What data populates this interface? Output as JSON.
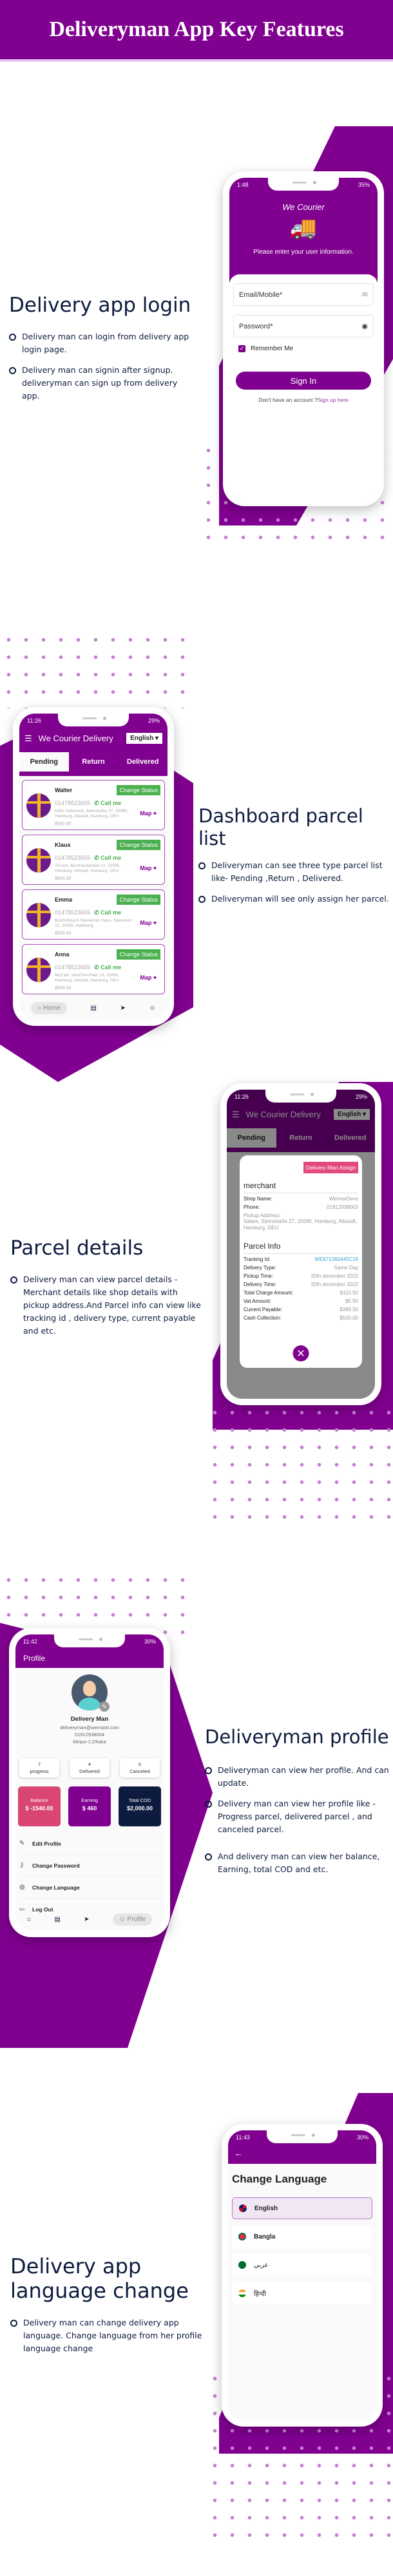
{
  "banner": {
    "title": "Deliveryman App Key Features"
  },
  "colors": {
    "brand": "#800090",
    "dot": "#c47fd1",
    "green": "#4cb050",
    "pink": "#e24a7e",
    "navy": "#0d1b3e"
  },
  "login": {
    "title": "Delivery app login",
    "bullets": [
      "Delivery man can login from delivery app login page.",
      "Delivery man can signin after signup. deliveryman can sign up from  delivery app."
    ],
    "phone": {
      "time": "1:48",
      "battery": "35%",
      "logo_text": "We Courier",
      "subtitle": "Please enter your user information.",
      "email_placeholder": "Email/Mobile*",
      "password_placeholder": "Password*",
      "remember": "Remember Me",
      "signin": "Sign In",
      "signup_prompt": "Don't have an account ?",
      "signup_link": "Sign up here"
    }
  },
  "dashboard": {
    "title": "Dashboard parcel list",
    "bullets": [
      "Deliveryman can see three type parcel list like- Pending ,Return , Delivered.",
      "Deliveryman will see only assign her parcel."
    ],
    "phone": {
      "time": "11:26",
      "battery": "29%",
      "app_title": "We Courier Delivery",
      "language": "English",
      "tabs": [
        "Pending",
        "Return",
        "Delivered"
      ],
      "change_status": "Change Status",
      "call_me": "Call me",
      "map": "Map",
      "parcels": [
        {
          "name": "Walter",
          "phone": "01478523655",
          "address": "Kölln Haferland, Steinstraße 27, 20095, Hamburg, Altstadt, Hamburg, DEU",
          "amount": "$500.00"
        },
        {
          "name": "Klaus",
          "phone": "01478523655",
          "address": "Trisons, Burchardstraße 22, 20095, Hamburg, Altstadt, Hamburg, DEU",
          "amount": "$500.00"
        },
        {
          "name": "Emma",
          "phone": "01478523655",
          "address": "Bischofsturm Steinernes Haus, Speersort 10, 20095, Hamburg, ...",
          "amount": "$500.00"
        },
        {
          "name": "Anna",
          "phone": "01478523655",
          "address": "McCafé, Ida-Ehre-Platz 10, 20095, Hamburg, Altstadt, Hamburg, DEU",
          "amount": "$500.00"
        }
      ],
      "nav_home": "Home"
    }
  },
  "details": {
    "title": "Parcel details",
    "bullets": [
      "Delivery man can view parcel details - Merchant details like  shop details with pickup address.And Parcel info can view like tracking id  ,  delivery type, current payable and etc."
    ],
    "phone": {
      "time": "11:26",
      "battery": "29%",
      "app_title": "We Courier Delivery",
      "language": "English",
      "tabs": [
        "Pending",
        "Return",
        "Delivered"
      ],
      "assign": "Delivery Man Assign",
      "merchant_heading": "merchant",
      "shop_label": "Shop Name:",
      "shop_value": "WemaxDevs",
      "phone_label": "Phone:",
      "phone_value": "01912938003",
      "pickup_label": "Pickup Address:",
      "pickup_value": "Salam, Steinstraße 27, 20095, Hamburg, Altstadt, Hamburg, DEU",
      "parcel_heading": "Parcel Info",
      "rows": [
        {
          "label": "Tracking Id:",
          "value": "WE671360445C19"
        },
        {
          "label": "Delivery Type:",
          "value": "Same Day"
        },
        {
          "label": "Pickup Time:",
          "value": "20th december 2022"
        },
        {
          "label": "Delivery Time:",
          "value": "20th december 2022"
        },
        {
          "label": "Total Charge Amount:",
          "value": "$110.50"
        },
        {
          "label": "Vat Amount:",
          "value": "$5.50"
        },
        {
          "label": "Current Payable:",
          "value": "$389.50"
        },
        {
          "label": "Cash Collection:",
          "value": "$500.00"
        }
      ]
    }
  },
  "profile": {
    "title": "Deliveryman profile",
    "bullets": [
      "Deliveryman can view her profile. And can update.",
      "Delivery man can view her profile like - Progress parcel, delivered parcel , and canceled parcel.",
      "And delivery man can view her balance, Earning, total COD and etc."
    ],
    "phone": {
      "time": "11:42",
      "battery": "30%",
      "header": "Profile",
      "name": "Delivery Man",
      "email": "deliveryman@wemaxit.com",
      "phone": "01912938004",
      "address": "Mirpur-2,Dhaka",
      "stats": [
        {
          "value": "7",
          "label": "progress"
        },
        {
          "value": "4",
          "label": "Delivered"
        },
        {
          "value": "0",
          "label": "Canceled"
        }
      ],
      "money": [
        {
          "label": "Balance",
          "value": "$ -1540.00"
        },
        {
          "label": "Earning",
          "value": "$ 460"
        },
        {
          "label": "Total COD",
          "value": "$2,000.00"
        }
      ],
      "menu": [
        "Edit Profile",
        "Change Password",
        "Change Language",
        "Log Out"
      ],
      "nav_profile": "Profile"
    }
  },
  "language": {
    "title": "Delivery app language change",
    "bullets": [
      "Delivery man can change delivery app language. Change language from her profile language change"
    ],
    "phone": {
      "time": "11:43",
      "battery": "30%",
      "heading": "Change Language",
      "options": [
        "English",
        "Bangla",
        "عربي",
        "हिन्दी"
      ],
      "selected": "English"
    }
  }
}
